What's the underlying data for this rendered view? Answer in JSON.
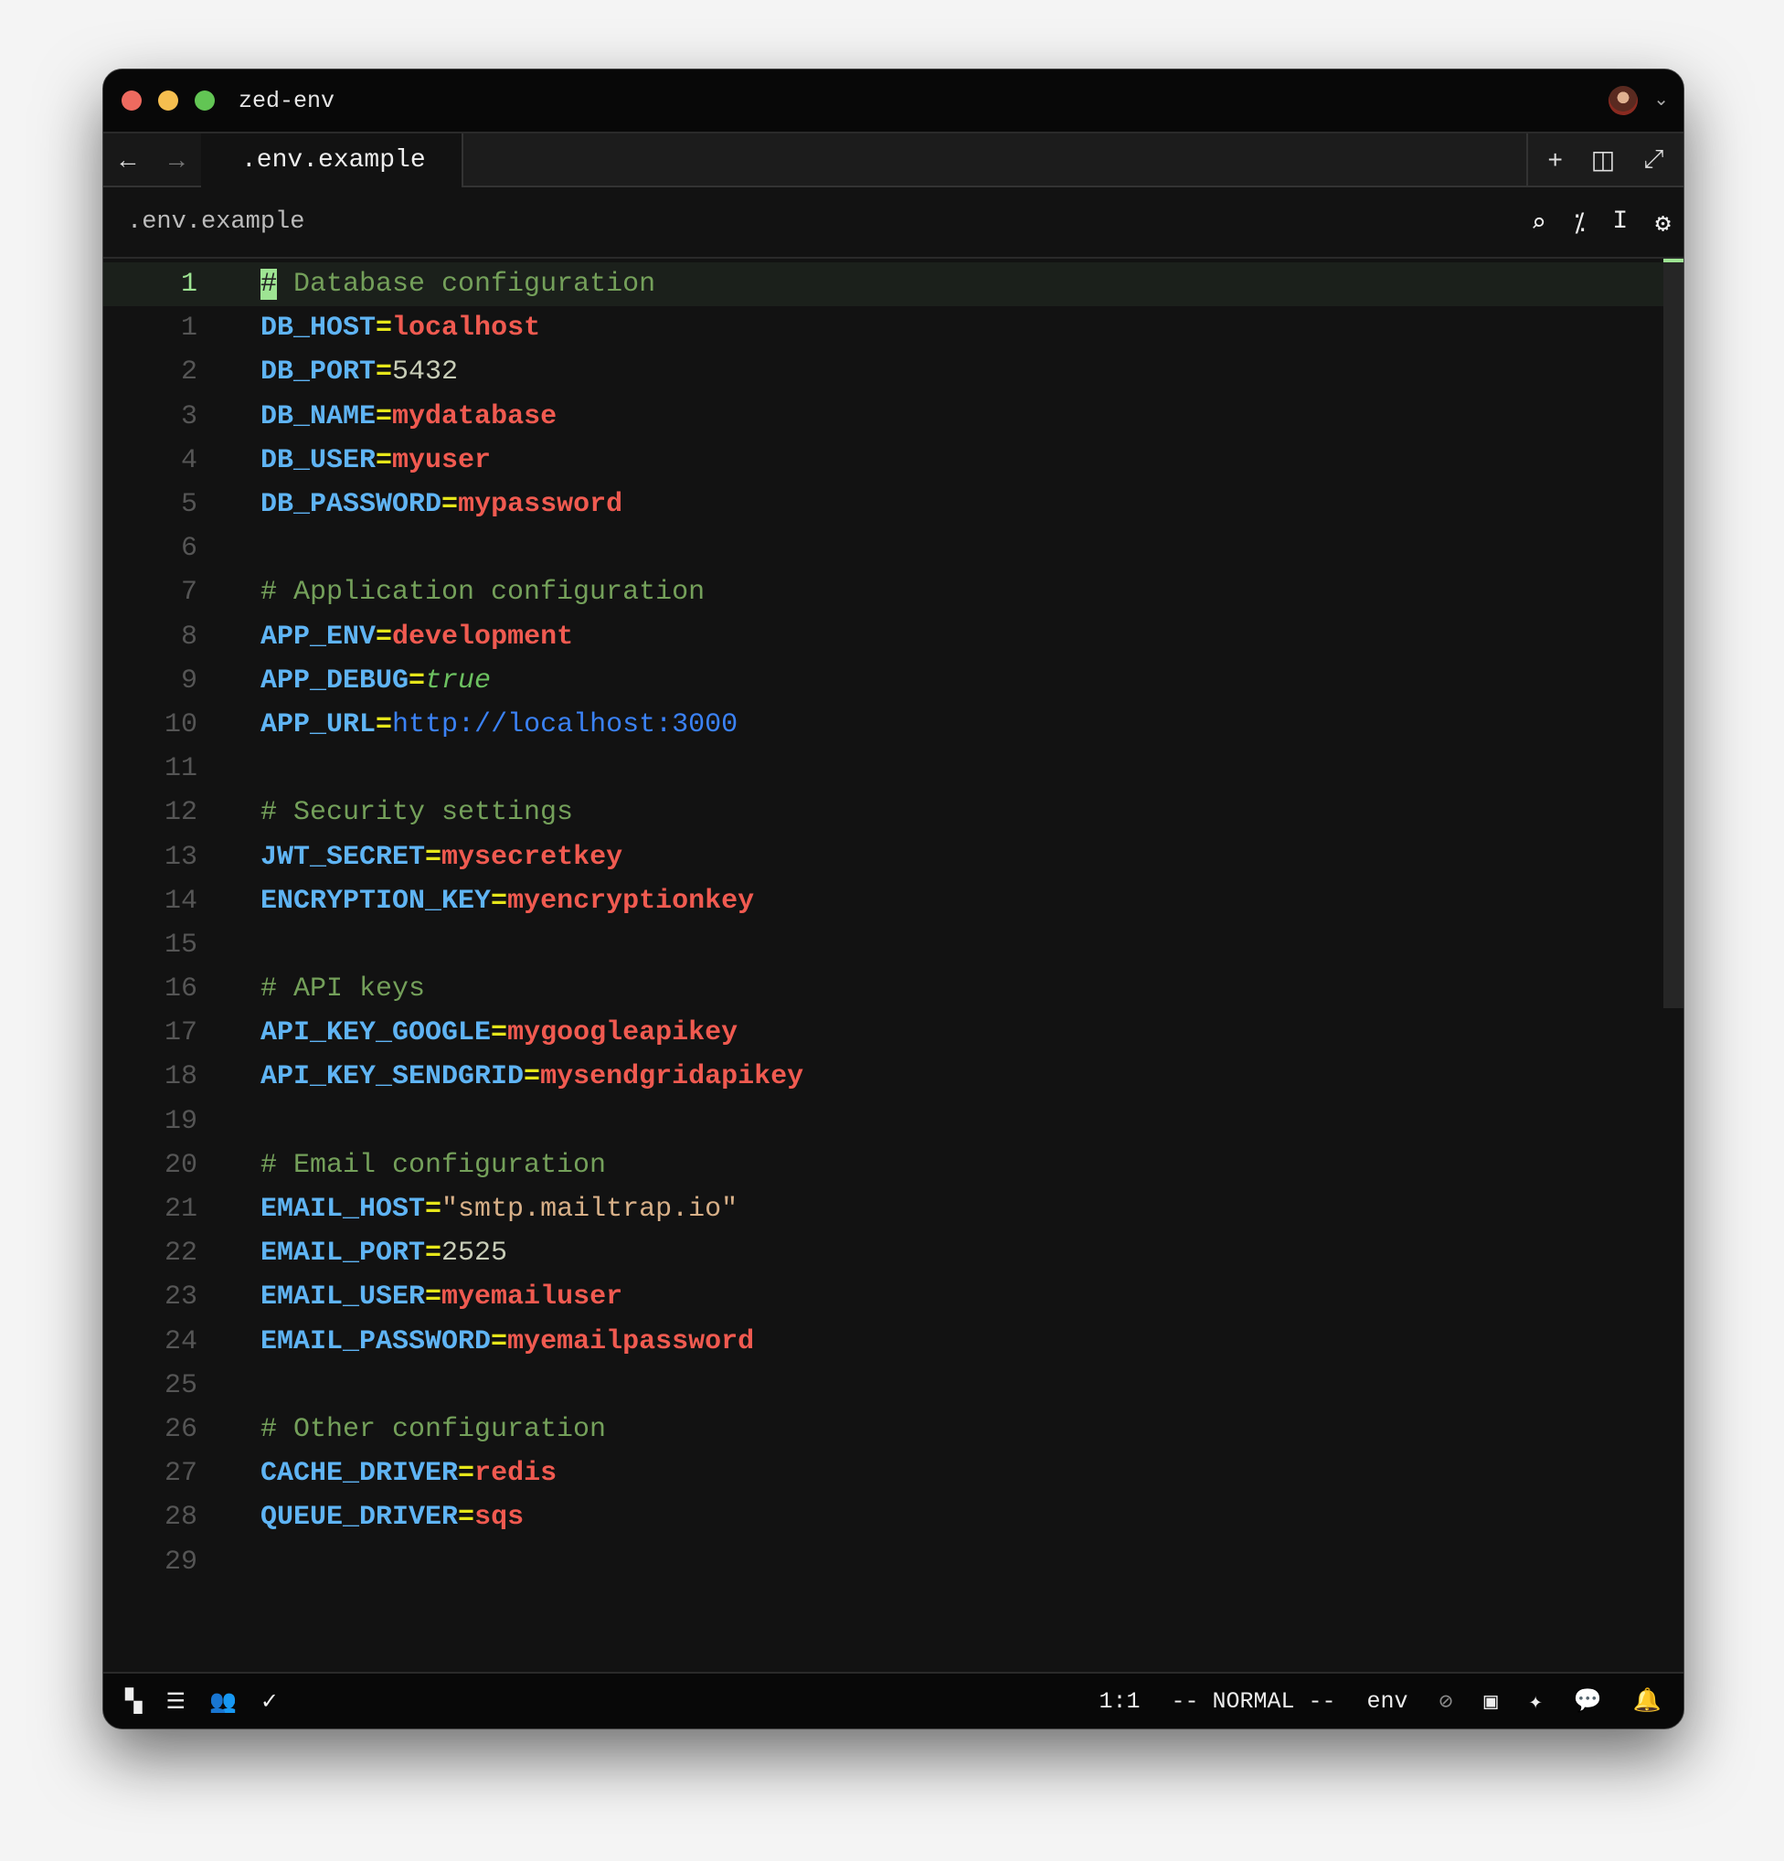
{
  "window": {
    "title": "zed-env",
    "traffic": [
      "#ee6a5f",
      "#f5be4f",
      "#62c554"
    ]
  },
  "tab": {
    "label": ".env.example"
  },
  "breadcrumb": ".env.example",
  "editor": {
    "current_line_number": "1",
    "lines": [
      {
        "n": "1",
        "parts": [
          [
            "c",
            "# Database configuration"
          ]
        ],
        "current": true
      },
      {
        "n": "1",
        "parts": [
          [
            "k",
            "DB_HOST"
          ],
          [
            "eq",
            "="
          ],
          [
            "v",
            "localhost"
          ]
        ]
      },
      {
        "n": "2",
        "parts": [
          [
            "k",
            "DB_PORT"
          ],
          [
            "eq",
            "="
          ],
          [
            "n",
            "5432"
          ]
        ]
      },
      {
        "n": "3",
        "parts": [
          [
            "k",
            "DB_NAME"
          ],
          [
            "eq",
            "="
          ],
          [
            "v",
            "mydatabase"
          ]
        ]
      },
      {
        "n": "4",
        "parts": [
          [
            "k",
            "DB_USER"
          ],
          [
            "eq",
            "="
          ],
          [
            "v",
            "myuser"
          ]
        ]
      },
      {
        "n": "5",
        "parts": [
          [
            "k",
            "DB_PASSWORD"
          ],
          [
            "eq",
            "="
          ],
          [
            "v",
            "mypassword"
          ]
        ]
      },
      {
        "n": "6",
        "parts": []
      },
      {
        "n": "7",
        "parts": [
          [
            "c",
            "# Application configuration"
          ]
        ]
      },
      {
        "n": "8",
        "parts": [
          [
            "k",
            "APP_ENV"
          ],
          [
            "eq",
            "="
          ],
          [
            "v",
            "development"
          ]
        ]
      },
      {
        "n": "9",
        "parts": [
          [
            "k",
            "APP_DEBUG"
          ],
          [
            "eq",
            "="
          ],
          [
            "b",
            "true"
          ]
        ]
      },
      {
        "n": "10",
        "parts": [
          [
            "k",
            "APP_URL"
          ],
          [
            "eq",
            "="
          ],
          [
            "u",
            "http://localhost:3000"
          ]
        ]
      },
      {
        "n": "11",
        "parts": []
      },
      {
        "n": "12",
        "parts": [
          [
            "c",
            "# Security settings"
          ]
        ]
      },
      {
        "n": "13",
        "parts": [
          [
            "k",
            "JWT_SECRET"
          ],
          [
            "eq",
            "="
          ],
          [
            "v",
            "mysecretkey"
          ]
        ]
      },
      {
        "n": "14",
        "parts": [
          [
            "k",
            "ENCRYPTION_KEY"
          ],
          [
            "eq",
            "="
          ],
          [
            "v",
            "myencryptionkey"
          ]
        ]
      },
      {
        "n": "15",
        "parts": []
      },
      {
        "n": "16",
        "parts": [
          [
            "c",
            "# API keys"
          ]
        ]
      },
      {
        "n": "17",
        "parts": [
          [
            "k",
            "API_KEY_GOOGLE"
          ],
          [
            "eq",
            "="
          ],
          [
            "v",
            "mygoogleapikey"
          ]
        ]
      },
      {
        "n": "18",
        "parts": [
          [
            "k",
            "API_KEY_SENDGRID"
          ],
          [
            "eq",
            "="
          ],
          [
            "v",
            "mysendgridapikey"
          ]
        ]
      },
      {
        "n": "19",
        "parts": []
      },
      {
        "n": "20",
        "parts": [
          [
            "c",
            "# Email configuration"
          ]
        ]
      },
      {
        "n": "21",
        "parts": [
          [
            "k",
            "EMAIL_HOST"
          ],
          [
            "eq",
            "="
          ],
          [
            "s",
            "\"smtp.mailtrap.io\""
          ]
        ]
      },
      {
        "n": "22",
        "parts": [
          [
            "k",
            "EMAIL_PORT"
          ],
          [
            "eq",
            "="
          ],
          [
            "n",
            "2525"
          ]
        ]
      },
      {
        "n": "23",
        "parts": [
          [
            "k",
            "EMAIL_USER"
          ],
          [
            "eq",
            "="
          ],
          [
            "v",
            "myemailuser"
          ]
        ]
      },
      {
        "n": "24",
        "parts": [
          [
            "k",
            "EMAIL_PASSWORD"
          ],
          [
            "eq",
            "="
          ],
          [
            "v",
            "myemailpassword"
          ]
        ]
      },
      {
        "n": "25",
        "parts": []
      },
      {
        "n": "26",
        "parts": [
          [
            "c",
            "# Other configuration"
          ]
        ]
      },
      {
        "n": "27",
        "parts": [
          [
            "k",
            "CACHE_DRIVER"
          ],
          [
            "eq",
            "="
          ],
          [
            "v",
            "redis"
          ]
        ]
      },
      {
        "n": "28",
        "parts": [
          [
            "k",
            "QUEUE_DRIVER"
          ],
          [
            "eq",
            "="
          ],
          [
            "v",
            "sqs"
          ]
        ]
      },
      {
        "n": "29",
        "parts": []
      }
    ]
  },
  "status": {
    "position": "1:1",
    "mode": "-- NORMAL --",
    "language": "env"
  }
}
